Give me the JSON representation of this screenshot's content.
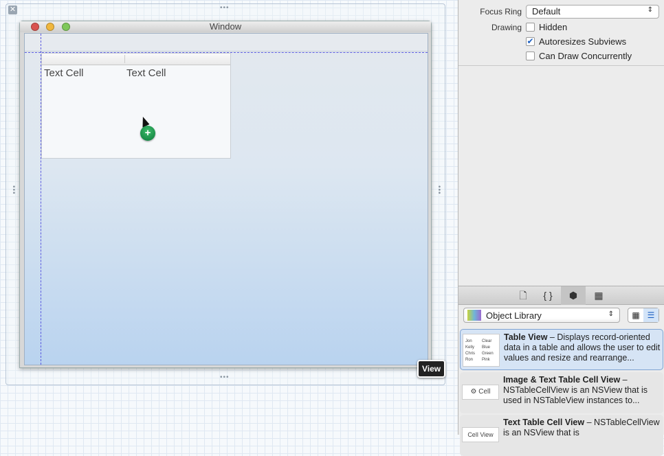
{
  "canvas": {
    "window_title": "Window",
    "cells": [
      "Text Cell",
      "Text Cell"
    ],
    "tooltip": "View"
  },
  "inspector": {
    "focus_ring_label": "Focus Ring",
    "focus_ring_value": "Default",
    "drawing_label": "Drawing",
    "checks": [
      {
        "label": "Hidden",
        "checked": false
      },
      {
        "label": "Autoresizes Subviews",
        "checked": true
      },
      {
        "label": "Can Draw Concurrently",
        "checked": false
      }
    ]
  },
  "library": {
    "tabs": [
      "file-template-icon",
      "code-snippet-icon",
      "object-cube-icon",
      "media-icon"
    ],
    "selected": "Object Library",
    "items": [
      {
        "title": "Table View",
        "desc": " – Displays record-oriented data in a table and allows the user to edit values and resize and rearrange...",
        "thumb": [
          "Jon",
          "Clear",
          "Kelly",
          "Blue",
          "Chris",
          "Green",
          "Ron",
          "Pink"
        ]
      },
      {
        "title": "Image & Text Table Cell View",
        "desc": " – NSTableCellView is an NSView that is used in NSTableView instances to...",
        "thumb_label": "Cell"
      },
      {
        "title": "Text Table Cell View",
        "desc": " – NSTableCellView is an NSView that is",
        "thumb_label": "Cell View"
      }
    ]
  }
}
